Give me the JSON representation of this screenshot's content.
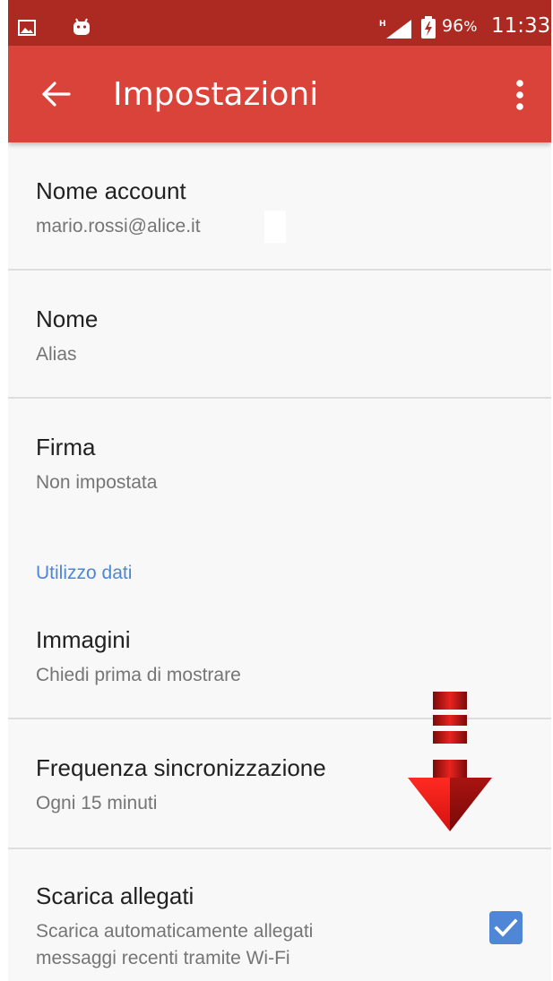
{
  "status_bar": {
    "battery": "96",
    "battery_unit": "%",
    "time": "11:33",
    "network": "H",
    "icons": [
      "gallery-icon",
      "android-icon",
      "signal-icon",
      "battery-icon"
    ]
  },
  "app_bar": {
    "title": "Impostazioni",
    "back_icon": "arrow-back-icon",
    "menu_icon": "more-vert-icon",
    "color": "#d9433a",
    "status_color": "#ad2a22"
  },
  "settings": {
    "account_name": {
      "title": "Nome account",
      "value": "mario.rossi@alice.it"
    },
    "name": {
      "title": "Nome",
      "value": "Alias"
    },
    "signature": {
      "title": "Firma",
      "value": "Non impostata"
    },
    "data_usage_header": "Utilizzo dati",
    "images": {
      "title": "Immagini",
      "value": "Chiedi prima di mostrare"
    },
    "sync_frequency": {
      "title": "Frequenza sincronizzazione",
      "value": "Ogni 15 minuti"
    },
    "download_attachments": {
      "title": "Scarica allegati",
      "value_line1": "Scarica automaticamente allegati",
      "value_line2": "messaggi recenti tramite Wi-Fi",
      "checked": true
    }
  },
  "accent_color": "#4f86d6"
}
